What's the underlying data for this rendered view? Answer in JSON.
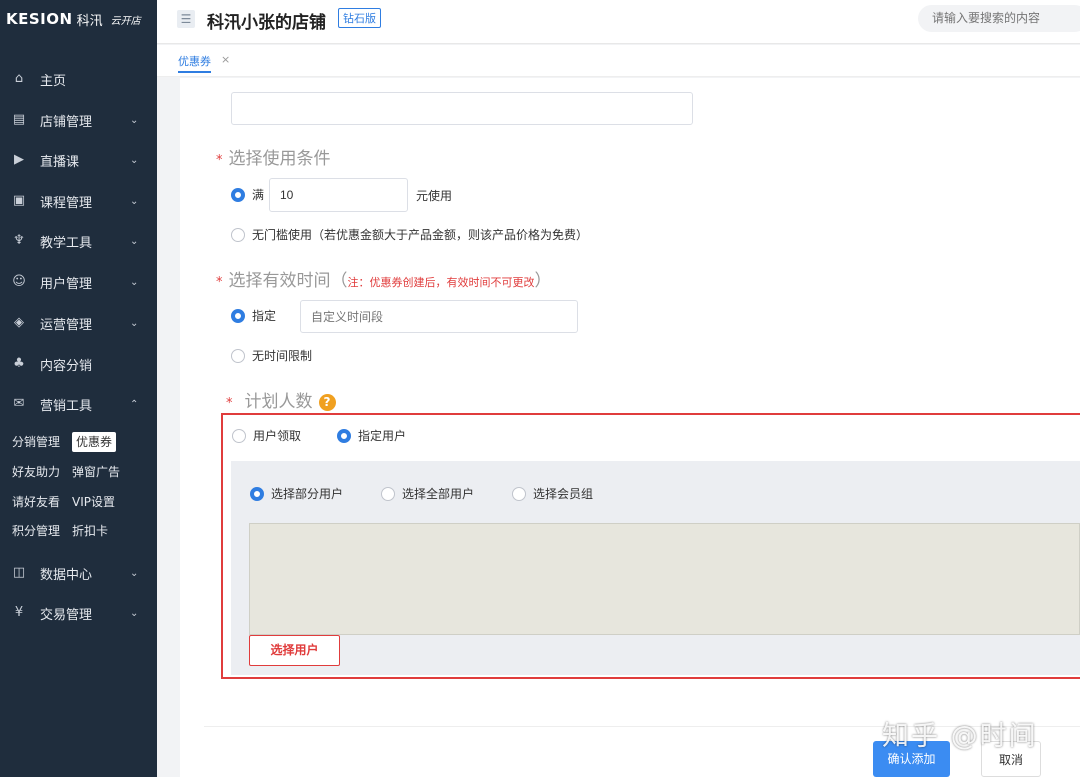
{
  "brand": {
    "logo_text": "KESION",
    "logo_cn": "科汛",
    "logo_sub": "云开店"
  },
  "header": {
    "menu_icon": "☰",
    "shop_title": "科汛小张的店铺",
    "level_badge": "钻石版",
    "search_placeholder": "请输入要搜索的内容"
  },
  "tabs": [
    {
      "label": "优惠券",
      "close": "×"
    }
  ],
  "sidebar": {
    "items": [
      {
        "icon": "home-icon",
        "glyph": "⌂",
        "label": "主页",
        "chevron": ""
      },
      {
        "icon": "store-icon",
        "glyph": "▤",
        "label": "店铺管理",
        "chevron": "⌄"
      },
      {
        "icon": "live-icon",
        "glyph": "▶",
        "label": "直播课",
        "chevron": "⌄"
      },
      {
        "icon": "course-icon",
        "glyph": "▣",
        "label": "课程管理",
        "chevron": "⌄"
      },
      {
        "icon": "tools-icon",
        "glyph": "♆",
        "label": "教学工具",
        "chevron": "⌄"
      },
      {
        "icon": "user-icon",
        "glyph": "☺",
        "label": "用户管理",
        "chevron": "⌄"
      },
      {
        "icon": "ops-icon",
        "glyph": "◈",
        "label": "运营管理",
        "chevron": "⌄"
      },
      {
        "icon": "share-icon",
        "glyph": "♣",
        "label": "内容分销",
        "chevron": ""
      },
      {
        "icon": "gift-icon",
        "glyph": "✉",
        "label": "营销工具",
        "chevron": "⌃"
      },
      {
        "icon": "data-icon",
        "glyph": "◫",
        "label": "数据中心",
        "chevron": "⌄"
      },
      {
        "icon": "money-icon",
        "glyph": "¥",
        "label": "交易管理",
        "chevron": "⌄"
      }
    ],
    "submenu": [
      [
        "分销管理",
        "优惠券"
      ],
      [
        "好友助力",
        "弹窗广告"
      ],
      [
        "请好友看",
        "VIP设置"
      ],
      [
        "积分管理",
        "折扣卡"
      ]
    ]
  },
  "form": {
    "condition": {
      "required_mark": "*",
      "title": "选择使用条件",
      "opt1_prefix": "满",
      "opt1_value": "10",
      "opt1_suffix": "元使用",
      "opt2": "无门槛使用（若优惠金额大于产品金额，则该产品价格为免费）"
    },
    "validity": {
      "required_mark": "*",
      "title": "选择有效时间",
      "paren_open": "（",
      "note": "注：优惠券创建后，有效时间不可更改",
      "paren_close": "）",
      "opt1": "指定",
      "opt1_placeholder": "自定义时间段",
      "opt2": "无时间限制"
    },
    "plan": {
      "required_mark": "*",
      "title": "计划人数",
      "help_icon": "?",
      "opt_claim": "用户领取",
      "opt_specified": "指定用户",
      "sub_opt1": "选择部分用户",
      "sub_opt2": "选择全部用户",
      "sub_opt3": "选择会员组",
      "select_button": "选择用户"
    }
  },
  "footer": {
    "confirm": "确认添加",
    "cancel": "取消"
  },
  "watermark": "知乎 @时间"
}
